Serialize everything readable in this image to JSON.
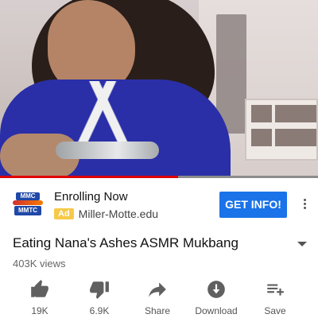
{
  "video": {
    "progress_fraction": 0.56
  },
  "ad": {
    "logo_text_top": "MMC",
    "logo_text_bottom": "MMTC",
    "title": "Enrolling Now",
    "badge": "Ad",
    "domain": "Miller-Motte.edu",
    "cta": "GET INFO!"
  },
  "meta": {
    "title": "Eating Nana's Ashes ASMR Mukbang",
    "views": "403K views"
  },
  "actions": [
    {
      "label": "19K",
      "icon": "thumbs-up-icon"
    },
    {
      "label": "6.9K",
      "icon": "thumbs-down-icon"
    },
    {
      "label": "Share",
      "icon": "share-icon"
    },
    {
      "label": "Download",
      "icon": "download-icon"
    },
    {
      "label": "Save",
      "icon": "playlist-add-icon"
    }
  ],
  "colors": {
    "accent_blue": "#1a73e8",
    "ad_badge": "#f7c948",
    "progress_red": "#e00000"
  }
}
